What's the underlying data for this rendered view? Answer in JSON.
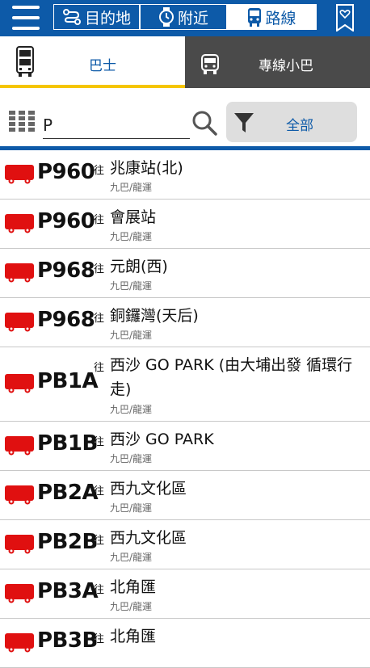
{
  "nav": {
    "menu_icon": "hamburger-icon",
    "segments": [
      {
        "label": "目的地",
        "icon": "route-icon",
        "active": false
      },
      {
        "label": "附近",
        "icon": "watch-icon",
        "active": false
      },
      {
        "label": "路線",
        "icon": "bus-front-icon",
        "active": true
      }
    ],
    "favorite_icon": "bookmark-heart-icon"
  },
  "tabs": [
    {
      "label": "巴士",
      "icon": "double-decker-icon",
      "active": true
    },
    {
      "label": "專線小巴",
      "icon": "minibus-icon",
      "active": false
    }
  ],
  "search": {
    "value": "P",
    "filter_label": "全部"
  },
  "routes": [
    {
      "route": "P960",
      "to": "往",
      "destination": "兆康站(北)",
      "operator": "九巴/龍運"
    },
    {
      "route": "P960",
      "to": "往",
      "destination": "會展站",
      "operator": "九巴/龍運"
    },
    {
      "route": "P968",
      "to": "往",
      "destination": "元朗(西)",
      "operator": "九巴/龍運"
    },
    {
      "route": "P968",
      "to": "往",
      "destination": "銅鑼灣(天后)",
      "operator": "九巴/龍運"
    },
    {
      "route": "PB1A",
      "to": "往",
      "destination": "西沙 GO PARK (由大埔出發 循環行走)",
      "operator": "九巴/龍運"
    },
    {
      "route": "PB1B",
      "to": "往",
      "destination": "西沙 GO PARK",
      "operator": "九巴/龍運"
    },
    {
      "route": "PB2A",
      "to": "往",
      "destination": "西九文化區",
      "operator": "九巴/龍運"
    },
    {
      "route": "PB2B",
      "to": "往",
      "destination": "西九文化區",
      "operator": "九巴/龍運"
    },
    {
      "route": "PB3A",
      "to": "往",
      "destination": "北角匯",
      "operator": "九巴/龍運"
    },
    {
      "route": "PB3B",
      "to": "往",
      "destination": "北角匯",
      "operator": ""
    }
  ],
  "colors": {
    "primary": "#0d5aa8",
    "accent": "#f5c500",
    "bus_red": "#e01010",
    "tab_dark": "#4a4a4a"
  }
}
